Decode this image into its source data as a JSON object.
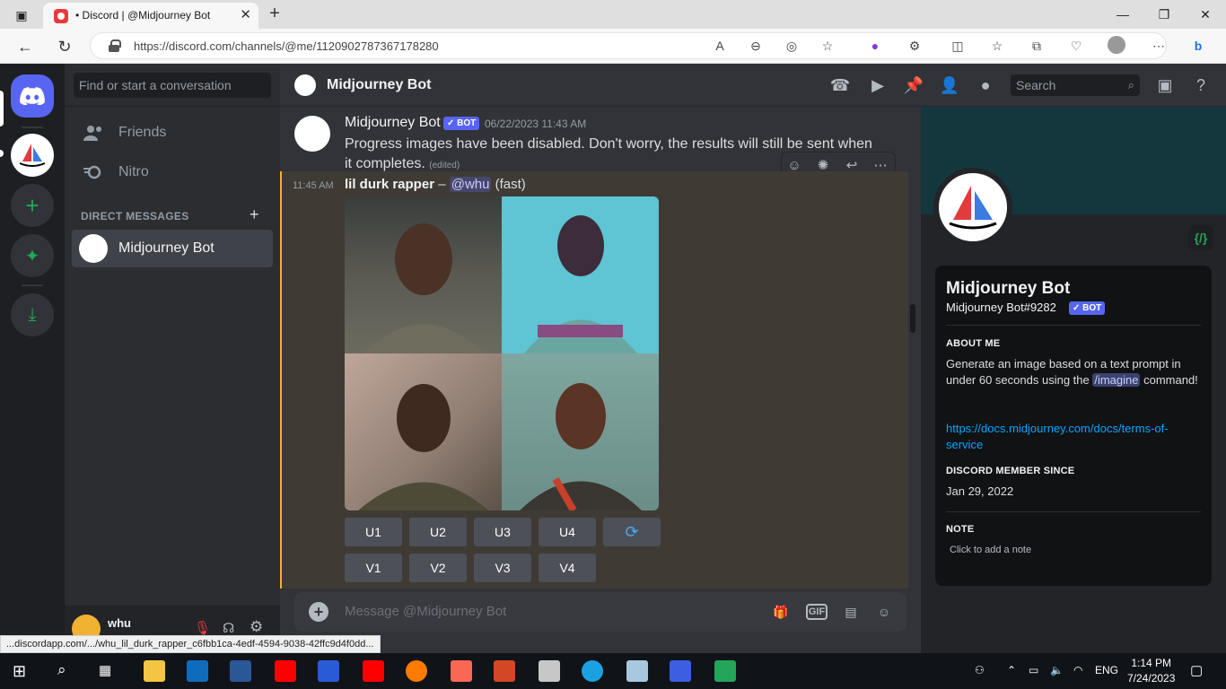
{
  "browser": {
    "tab_title": "• Discord | @Midjourney Bot",
    "url": "https://discord.com/channels/@me/1120902787367178280",
    "status_url": "...discordapp.com/.../whu_lil_durk_rapper_c6fbb1ca-4edf-4594-9038-42ffc9d4f0dd..."
  },
  "sidebar": {
    "search_placeholder": "Find or start a conversation",
    "nav": [
      {
        "label": "Friends",
        "icon": "friends-icon"
      },
      {
        "label": "Nitro",
        "icon": "nitro-icon"
      }
    ],
    "dm_header": "DIRECT MESSAGES",
    "dm_items": [
      {
        "label": "Midjourney Bot"
      }
    ],
    "user": {
      "name": "whu"
    }
  },
  "chat": {
    "title": "Midjourney Bot",
    "search_placeholder": "Search",
    "composer_placeholder": "Message @Midjourney Bot",
    "gif_label": "GIF",
    "messages": [
      {
        "author": "Midjourney Bot",
        "bot_tag": "✓ BOT",
        "time": "06/22/2023 11:43 AM",
        "text": "Progress images have been disabled. Don't worry, the results will still be sent when it completes.",
        "edited": "(edited)"
      },
      {
        "time": "11:45 AM",
        "prompt": "lil durk rapper",
        "dash": " – ",
        "mention": "@whu",
        "mode": " (fast)",
        "buttons_row1": [
          "U1",
          "U2",
          "U3",
          "U4"
        ],
        "buttons_row2": [
          "V1",
          "V2",
          "V3",
          "V4"
        ]
      }
    ]
  },
  "profile": {
    "name": "Midjourney Bot",
    "tag": "Midjourney Bot#9282",
    "bot_tag": "✓ BOT",
    "about_header": "ABOUT ME",
    "about_pre": "Generate an image based on a text prompt in under 60 seconds using the ",
    "about_cmd": "/imagine",
    "about_post": " command!",
    "link": "https://docs.midjourney.com/docs/terms-of-service",
    "since_header": "DISCORD MEMBER SINCE",
    "since": "Jan 29, 2022",
    "note_header": "NOTE",
    "note_placeholder": "Click to add a note"
  },
  "taskbar": {
    "lang": "ENG",
    "time": "1:14 PM",
    "date": "7/24/2023"
  },
  "colors": {
    "blurple": "#5865f2",
    "highlight": "#f0b232",
    "link": "#00a8fc"
  }
}
